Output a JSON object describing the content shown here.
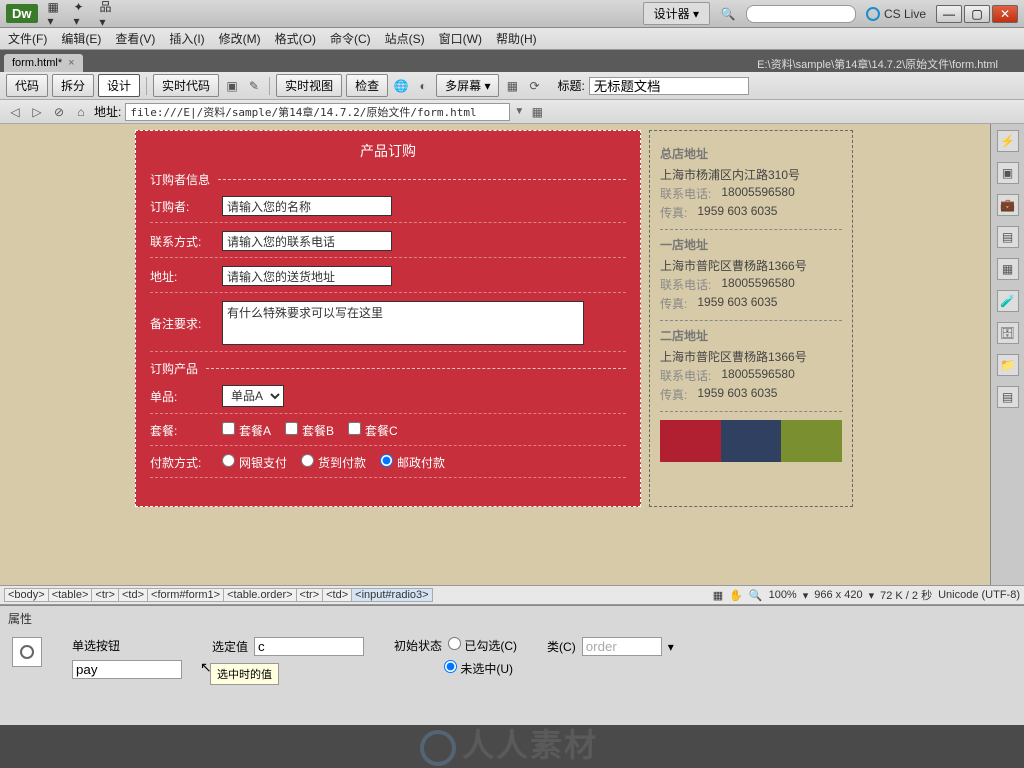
{
  "appbar": {
    "logo": "Dw",
    "designer": "设计器",
    "cslive": "CS Live"
  },
  "menu": [
    "文件(F)",
    "编辑(E)",
    "查看(V)",
    "插入(I)",
    "修改(M)",
    "格式(O)",
    "命令(C)",
    "站点(S)",
    "窗口(W)",
    "帮助(H)"
  ],
  "tab": {
    "name": "form.html*",
    "path": "E:\\资料\\sample\\第14章\\14.7.2\\原始文件\\form.html"
  },
  "doc_toolbar": {
    "code": "代码",
    "split": "拆分",
    "design": "设计",
    "live_code": "实时代码",
    "live_view": "实时视图",
    "inspect": "检查",
    "multiscreen": "多屏幕",
    "title_label": "标题:",
    "title_value": "无标题文档"
  },
  "addr": {
    "label": "地址:",
    "value": "file:///E|/资料/sample/第14章/14.7.2/原始文件/form.html"
  },
  "form": {
    "title": "产品订购",
    "sec1": "订购者信息",
    "buyer_lbl": "订购者:",
    "buyer_ph": "请输入您的名称",
    "contact_lbl": "联系方式:",
    "contact_ph": "请输入您的联系电话",
    "addr_lbl": "地址:",
    "addr_ph": "请输入您的送货地址",
    "note_lbl": "备注要求:",
    "note_ph": "有什么特殊要求可以写在这里",
    "sec2": "订购产品",
    "single_lbl": "单品:",
    "single_opt": "单品A",
    "combo_lbl": "套餐:",
    "combo_a": "套餐A",
    "combo_b": "套餐B",
    "combo_c": "套餐C",
    "pay_lbl": "付款方式:",
    "pay_a": "网银支付",
    "pay_b": "货到付款",
    "pay_c": "邮政付款"
  },
  "side": {
    "s1": {
      "ttl": "总店地址",
      "addr": "上海市杨浦区内江路310号",
      "tel_k": "联系电话:",
      "tel": "18005596580",
      "fax_k": "传真:",
      "fax": "1959 603 6035"
    },
    "s2": {
      "ttl": "一店地址",
      "addr": "上海市普陀区曹杨路1366号",
      "tel_k": "联系电话:",
      "tel": "18005596580",
      "fax_k": "传真:",
      "fax": "1959 603 6035"
    },
    "s3": {
      "ttl": "二店地址",
      "addr": "上海市普陀区曹杨路1366号",
      "tel_k": "联系电话:",
      "tel": "18005596580",
      "fax_k": "传真:",
      "fax": "1959 603 6035"
    }
  },
  "tags": [
    "<body>",
    "<table>",
    "<tr>",
    "<td>",
    "<form#form1>",
    "<table.order>",
    "<tr>",
    "<td>",
    "<input#radio3>"
  ],
  "status": {
    "zoom": "100%",
    "dims": "966 x 420",
    "size": "72 K / 2 秒",
    "enc": "Unicode (UTF-8)"
  },
  "props": {
    "title": "属性",
    "type": "单选按钮",
    "name_val": "pay",
    "selval_lbl": "选定值",
    "selval": "c",
    "tooltip": "选中时的值",
    "init_lbl": "初始状态",
    "checked": "已勾选(C)",
    "unchecked": "未选中(U)",
    "class_lbl": "类(C)",
    "class_val": "order"
  },
  "watermark": "人人素材"
}
